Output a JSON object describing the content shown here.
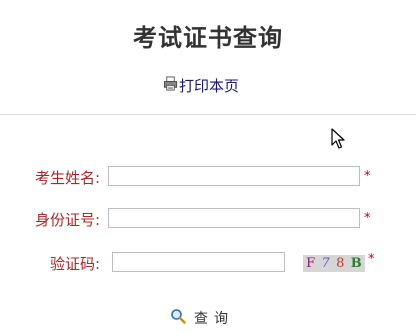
{
  "page": {
    "title": "考试证书查询"
  },
  "print": {
    "label": "打印本页",
    "icon": "printer-icon"
  },
  "form": {
    "name_label": "考生姓名:",
    "id_label": "身份证号:",
    "captcha_label": "验证码:",
    "name_value": "",
    "id_value": "",
    "captcha_value": "",
    "required_mark": "*"
  },
  "captcha": {
    "chars": [
      "F",
      "7",
      "8",
      "B"
    ]
  },
  "query": {
    "label": "查询",
    "icon": "search-icon"
  }
}
